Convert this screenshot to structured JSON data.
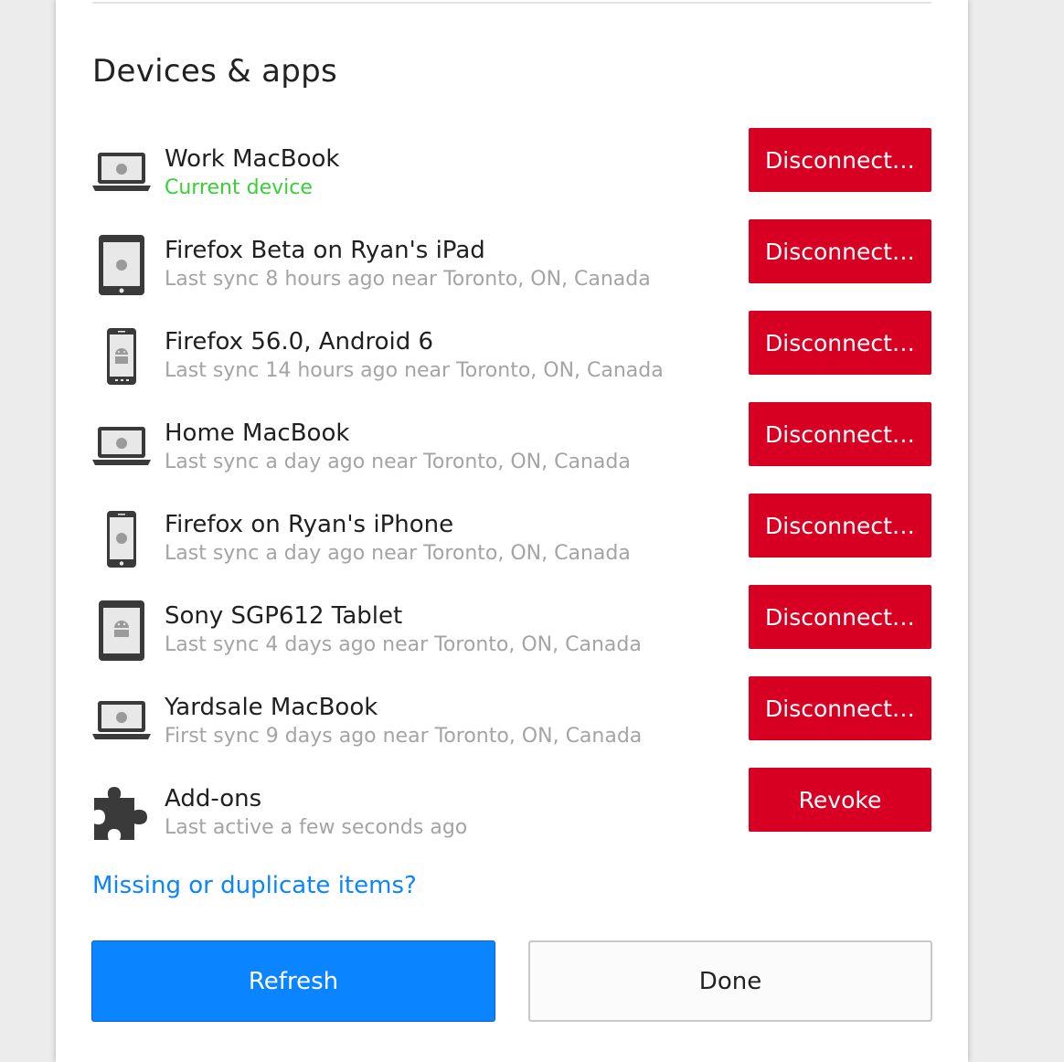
{
  "section": {
    "title": "Devices & apps"
  },
  "devices": [
    {
      "icon": "laptop-icon",
      "name": "Work MacBook",
      "status": "Current device",
      "action": "Disconnect…"
    },
    {
      "icon": "tablet-ios-icon",
      "name": "Firefox Beta on Ryan's iPad",
      "status": "Last sync 8 hours ago near Toronto, ON, Canada",
      "action": "Disconnect…"
    },
    {
      "icon": "phone-android-icon",
      "name": "Firefox 56.0, Android 6",
      "status": "Last sync 14 hours ago near Toronto, ON, Canada",
      "action": "Disconnect…"
    },
    {
      "icon": "laptop-icon",
      "name": "Home MacBook",
      "status": "Last sync a day ago near Toronto, ON, Canada",
      "action": "Disconnect…"
    },
    {
      "icon": "phone-ios-icon",
      "name": "Firefox on Ryan's iPhone",
      "status": "Last sync a day ago near Toronto, ON, Canada",
      "action": "Disconnect…"
    },
    {
      "icon": "tablet-android-icon",
      "name": "Sony SGP612 Tablet",
      "status": "Last sync 4 days ago near Toronto, ON, Canada",
      "action": "Disconnect…"
    },
    {
      "icon": "laptop-icon",
      "name": "Yardsale MacBook",
      "status": "First sync 9 days ago near Toronto, ON, Canada",
      "action": "Disconnect…"
    },
    {
      "icon": "puzzle-piece-icon",
      "name": "Add-ons",
      "status": "Last active a few seconds ago",
      "action": "Revoke"
    }
  ],
  "help_link": "Missing or duplicate items?",
  "footer": {
    "refresh_label": "Refresh",
    "done_label": "Done"
  },
  "colors": {
    "danger_button": "#d70022",
    "primary_button": "#0a84ff",
    "current_device_text": "#37d137",
    "link": "#0a84ff"
  }
}
